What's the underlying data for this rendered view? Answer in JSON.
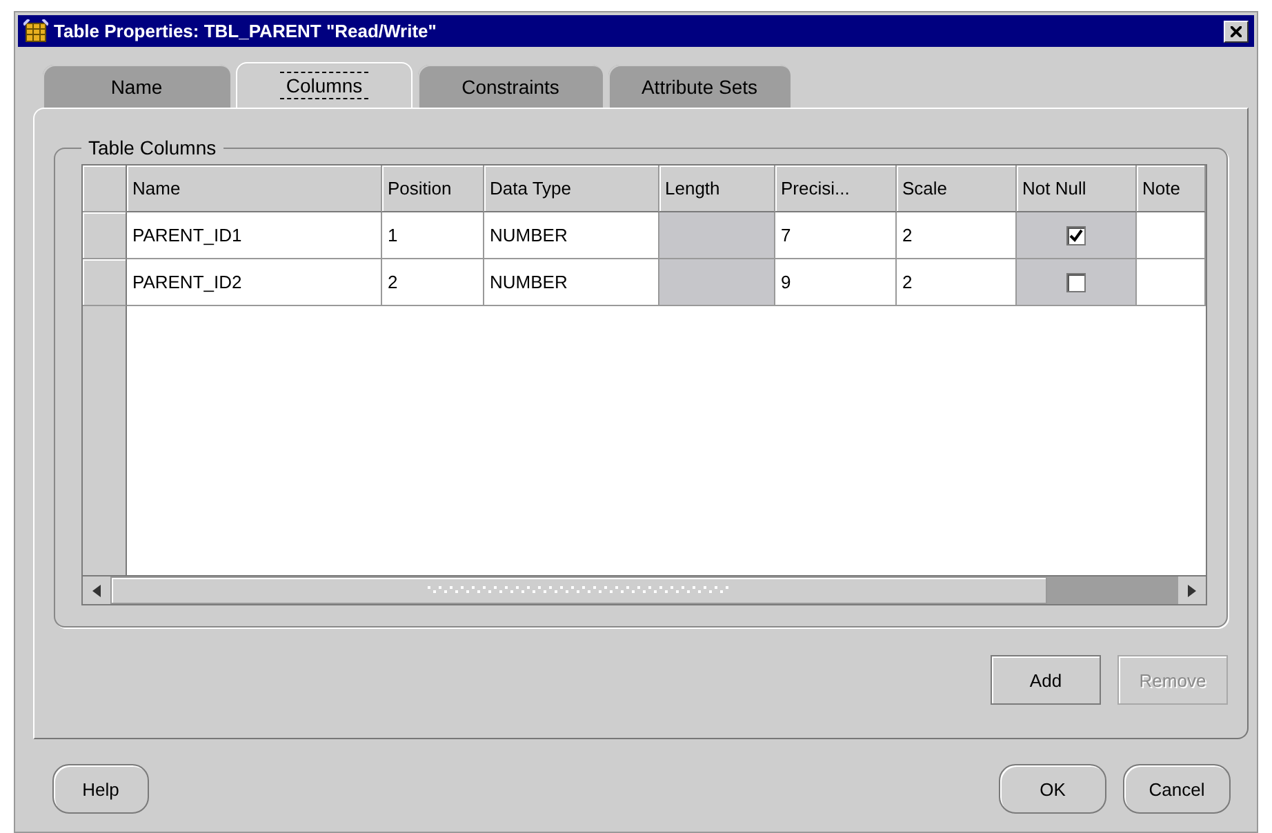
{
  "window": {
    "title": "Table Properties: TBL_PARENT \"Read/Write\""
  },
  "tabs": [
    {
      "label": "Name",
      "selected": false
    },
    {
      "label": "Columns",
      "selected": true
    },
    {
      "label": "Constraints",
      "selected": false
    },
    {
      "label": "Attribute Sets",
      "selected": false
    }
  ],
  "group": {
    "title": "Table Columns"
  },
  "table": {
    "columns": [
      "Name",
      "Position",
      "Data Type",
      "Length",
      "Precisi...",
      "Scale",
      "Not Null",
      "Note"
    ],
    "rows": [
      {
        "cells": [
          {
            "kind": "text",
            "text": "PARENT_ID1"
          },
          {
            "kind": "text",
            "text": "1"
          },
          {
            "kind": "text",
            "text": "NUMBER"
          },
          {
            "kind": "disabled"
          },
          {
            "kind": "text",
            "text": "7"
          },
          {
            "kind": "text",
            "text": "2"
          },
          {
            "kind": "checkbox",
            "checked": true
          },
          {
            "kind": "empty"
          }
        ]
      },
      {
        "cells": [
          {
            "kind": "text",
            "text": "PARENT_ID2"
          },
          {
            "kind": "text",
            "text": "2"
          },
          {
            "kind": "text",
            "text": "NUMBER"
          },
          {
            "kind": "disabled"
          },
          {
            "kind": "text",
            "text": "9"
          },
          {
            "kind": "text",
            "text": "2"
          },
          {
            "kind": "checkbox",
            "checked": false
          },
          {
            "kind": "empty"
          }
        ]
      }
    ]
  },
  "table_buttons": [
    {
      "label": "Add",
      "disabled": false
    },
    {
      "label": "Remove",
      "disabled": true
    }
  ],
  "footer_left": [
    {
      "label": "Help",
      "disabled": false
    }
  ],
  "footer_right": [
    {
      "label": "OK",
      "disabled": false
    },
    {
      "label": "Cancel",
      "disabled": false
    }
  ]
}
